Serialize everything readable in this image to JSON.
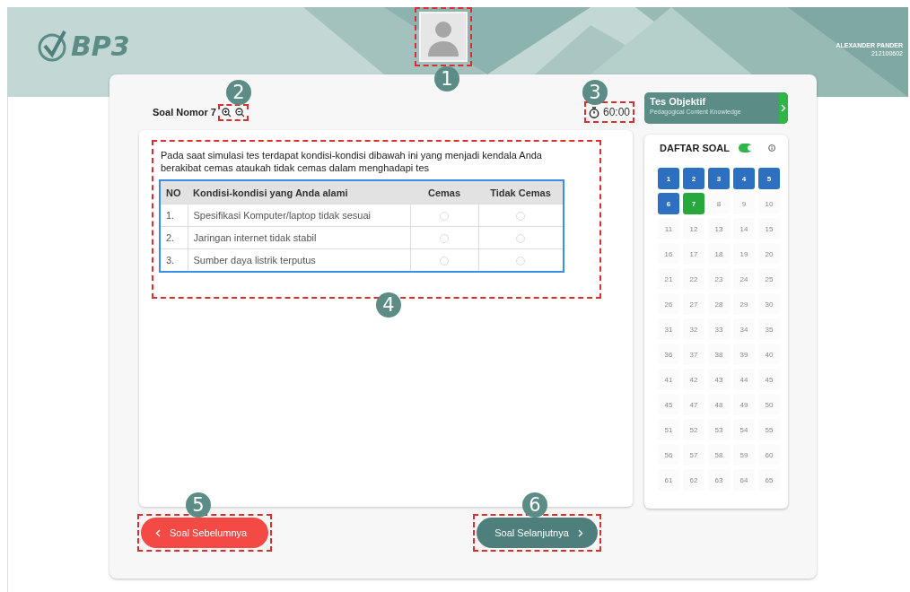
{
  "header": {
    "logo": "BP3",
    "user_name": "ALEXANDER PANDER",
    "user_id": "212100602"
  },
  "question": {
    "title": "Soal Nomor 7",
    "timer": "60:00",
    "text": "Pada saat simulasi tes terdapat kondisi-kondisi dibawah ini yang menjadi kendala Anda berakibat cemas ataukah tidak cemas dalam menghadapi tes",
    "table": {
      "columns": [
        "NO",
        "Kondisi-kondisi yang Anda alami",
        "Cemas",
        "Tidak Cemas"
      ],
      "rows": [
        {
          "no": "1.",
          "condition": "Spesifikasi Komputer/laptop tidak sesuai",
          "cemas_selected": false,
          "tidak_cemas_selected": false
        },
        {
          "no": "2.",
          "condition": "Jaringan internet tidak stabil",
          "cemas_selected": false,
          "tidak_cemas_selected": false
        },
        {
          "no": "3.",
          "condition": "Sumber daya listrik terputus",
          "cemas_selected": false,
          "tidak_cemas_selected": false
        }
      ]
    }
  },
  "section": {
    "title": "Tes Objektif",
    "subtitle": "Pedagogical Content Knowledge"
  },
  "question_list": {
    "title": "DAFTAR SOAL",
    "toggle_on": true,
    "items": [
      {
        "label": "1",
        "answered": true,
        "current": false
      },
      {
        "label": "2",
        "answered": true,
        "current": false
      },
      {
        "label": "3",
        "answered": true,
        "current": false
      },
      {
        "label": "4",
        "answered": true,
        "current": false
      },
      {
        "label": "5",
        "answered": true,
        "current": false
      },
      {
        "label": "6",
        "answered": true,
        "current": false
      },
      {
        "label": "7",
        "answered": false,
        "current": true
      },
      {
        "label": "8",
        "answered": false,
        "current": false
      },
      {
        "label": "9",
        "answered": false,
        "current": false
      },
      {
        "label": "10",
        "answered": false,
        "current": false
      },
      {
        "label": "11",
        "answered": false,
        "current": false
      },
      {
        "label": "12",
        "answered": false,
        "current": false
      },
      {
        "label": "13",
        "answered": false,
        "current": false
      },
      {
        "label": "14",
        "answered": false,
        "current": false
      },
      {
        "label": "15",
        "answered": false,
        "current": false
      },
      {
        "label": "16",
        "answered": false,
        "current": false
      },
      {
        "label": "17",
        "answered": false,
        "current": false
      },
      {
        "label": "18",
        "answered": false,
        "current": false
      },
      {
        "label": "19",
        "answered": false,
        "current": false
      },
      {
        "label": "20",
        "answered": false,
        "current": false
      },
      {
        "label": "21",
        "answered": false,
        "current": false
      },
      {
        "label": "22",
        "answered": false,
        "current": false
      },
      {
        "label": "23",
        "answered": false,
        "current": false
      },
      {
        "label": "24",
        "answered": false,
        "current": false
      },
      {
        "label": "25",
        "answered": false,
        "current": false
      },
      {
        "label": "26",
        "answered": false,
        "current": false
      },
      {
        "label": "27",
        "answered": false,
        "current": false
      },
      {
        "label": "28",
        "answered": false,
        "current": false
      },
      {
        "label": "29",
        "answered": false,
        "current": false
      },
      {
        "label": "30",
        "answered": false,
        "current": false
      },
      {
        "label": "31",
        "answered": false,
        "current": false
      },
      {
        "label": "32",
        "answered": false,
        "current": false
      },
      {
        "label": "33",
        "answered": false,
        "current": false
      },
      {
        "label": "34",
        "answered": false,
        "current": false
      },
      {
        "label": "35",
        "answered": false,
        "current": false
      },
      {
        "label": "36",
        "answered": false,
        "current": false
      },
      {
        "label": "37",
        "answered": false,
        "current": false
      },
      {
        "label": "38",
        "answered": false,
        "current": false
      },
      {
        "label": "39",
        "answered": false,
        "current": false
      },
      {
        "label": "40",
        "answered": false,
        "current": false
      },
      {
        "label": "41",
        "answered": false,
        "current": false
      },
      {
        "label": "42",
        "answered": false,
        "current": false
      },
      {
        "label": "43",
        "answered": false,
        "current": false
      },
      {
        "label": "44",
        "answered": false,
        "current": false
      },
      {
        "label": "45",
        "answered": false,
        "current": false
      },
      {
        "label": "45",
        "answered": false,
        "current": false
      },
      {
        "label": "47",
        "answered": false,
        "current": false
      },
      {
        "label": "48",
        "answered": false,
        "current": false
      },
      {
        "label": "49",
        "answered": false,
        "current": false
      },
      {
        "label": "50",
        "answered": false,
        "current": false
      },
      {
        "label": "51",
        "answered": false,
        "current": false
      },
      {
        "label": "52",
        "answered": false,
        "current": false
      },
      {
        "label": "53",
        "answered": false,
        "current": false
      },
      {
        "label": "54",
        "answered": false,
        "current": false
      },
      {
        "label": "55",
        "answered": false,
        "current": false
      },
      {
        "label": "56",
        "answered": false,
        "current": false
      },
      {
        "label": "57",
        "answered": false,
        "current": false
      },
      {
        "label": "58",
        "answered": false,
        "current": false
      },
      {
        "label": "59",
        "answered": false,
        "current": false
      },
      {
        "label": "60",
        "answered": false,
        "current": false
      },
      {
        "label": "61",
        "answered": false,
        "current": false
      },
      {
        "label": "62",
        "answered": false,
        "current": false
      },
      {
        "label": "63",
        "answered": false,
        "current": false
      },
      {
        "label": "64",
        "answered": false,
        "current": false
      },
      {
        "label": "65",
        "answered": false,
        "current": false
      }
    ]
  },
  "buttons": [
    {
      "label": "Soal Sebelumnya",
      "kind": "previous"
    },
    {
      "label": "Soal Selanjutnya",
      "kind": "next"
    }
  ],
  "callouts": [
    "1",
    "2",
    "3",
    "4",
    "5",
    "6"
  ]
}
